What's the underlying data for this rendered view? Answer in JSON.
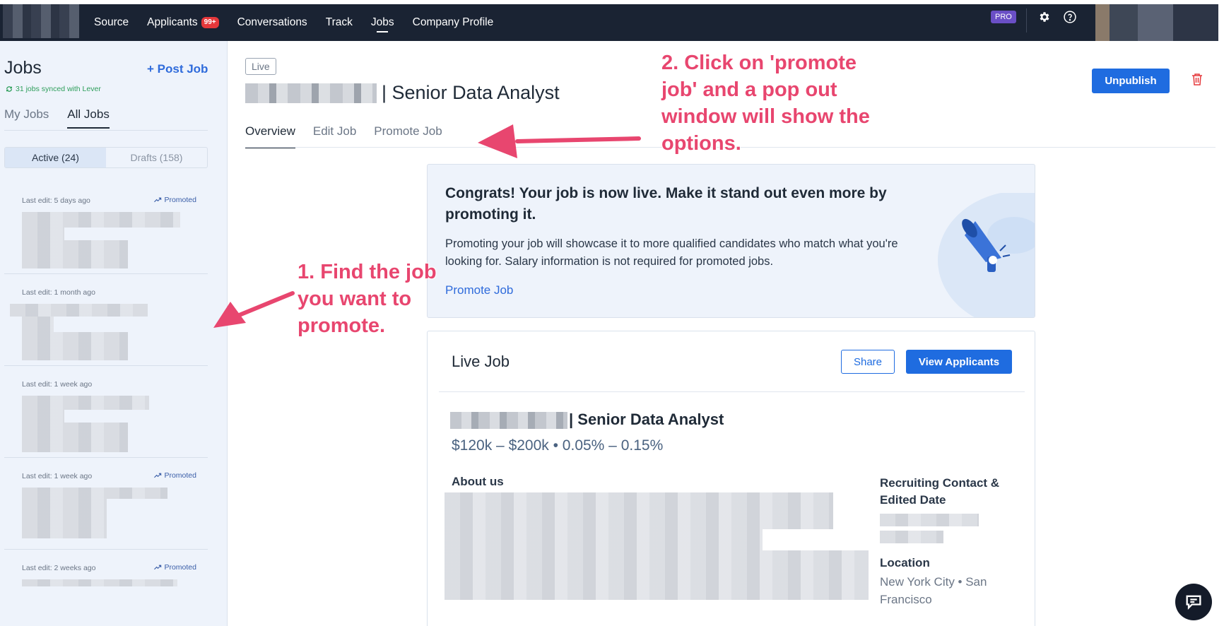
{
  "nav": {
    "items": [
      {
        "label": "Source"
      },
      {
        "label": "Applicants",
        "badge": "99+"
      },
      {
        "label": "Conversations"
      },
      {
        "label": "Track"
      },
      {
        "label": "Jobs",
        "active": true
      },
      {
        "label": "Company Profile"
      }
    ],
    "pro_badge": "PRO",
    "icons": [
      "gear-icon",
      "help-icon"
    ]
  },
  "sidebar": {
    "title": "Jobs",
    "post_job": "+ Post Job",
    "sync_text": "31 jobs synced with Lever",
    "tabs": [
      "My Jobs",
      "All Jobs"
    ],
    "active_tab": "All Jobs",
    "segments": [
      "Active (24)",
      "Drafts (158)"
    ],
    "active_segment": "Active (24)",
    "jobs": [
      {
        "last_edit": "Last edit: 5 days ago",
        "promoted": "Promoted"
      },
      {
        "last_edit": "Last edit: 1 month ago",
        "promoted": ""
      },
      {
        "last_edit": "Last edit: 1 week ago",
        "promoted": ""
      },
      {
        "last_edit": "Last edit: 1 week ago",
        "promoted": "Promoted"
      },
      {
        "last_edit": "Last edit: 2 weeks ago",
        "promoted": "Promoted"
      }
    ]
  },
  "main": {
    "status_tag": "Live",
    "job_title": "| Senior Data Analyst",
    "tabs": [
      "Overview",
      "Edit Job",
      "Promote Job"
    ],
    "active_tab": "Overview",
    "unpublish_label": "Unpublish",
    "promo": {
      "heading": "Congrats! Your job is now live. Make it stand out even more by promoting it.",
      "body": "Promoting your job will showcase it to more qualified candidates who match what you're looking for. Salary information is not required for promoted jobs.",
      "link": "Promote Job"
    },
    "live_job": {
      "title": "Live Job",
      "share_label": "Share",
      "view_applicants_label": "View Applicants",
      "job_title": "| Senior Data Analyst",
      "compensation": "$120k – $200k • 0.05% – 0.15%",
      "about_heading": "About us",
      "recruiting_heading": "Recruiting Contact & Edited Date",
      "location_heading": "Location",
      "location": "New York City • San Francisco"
    }
  },
  "annotations": {
    "step1": "1. Find the job you want to promote.",
    "step2": "2. Click on 'promote job' and a pop out window will show the options."
  },
  "colors": {
    "nav_bg": "#1a2333",
    "accent": "#1f6ce0",
    "annotation": "#e8466f",
    "sidebar_bg": "#eef3fb"
  }
}
